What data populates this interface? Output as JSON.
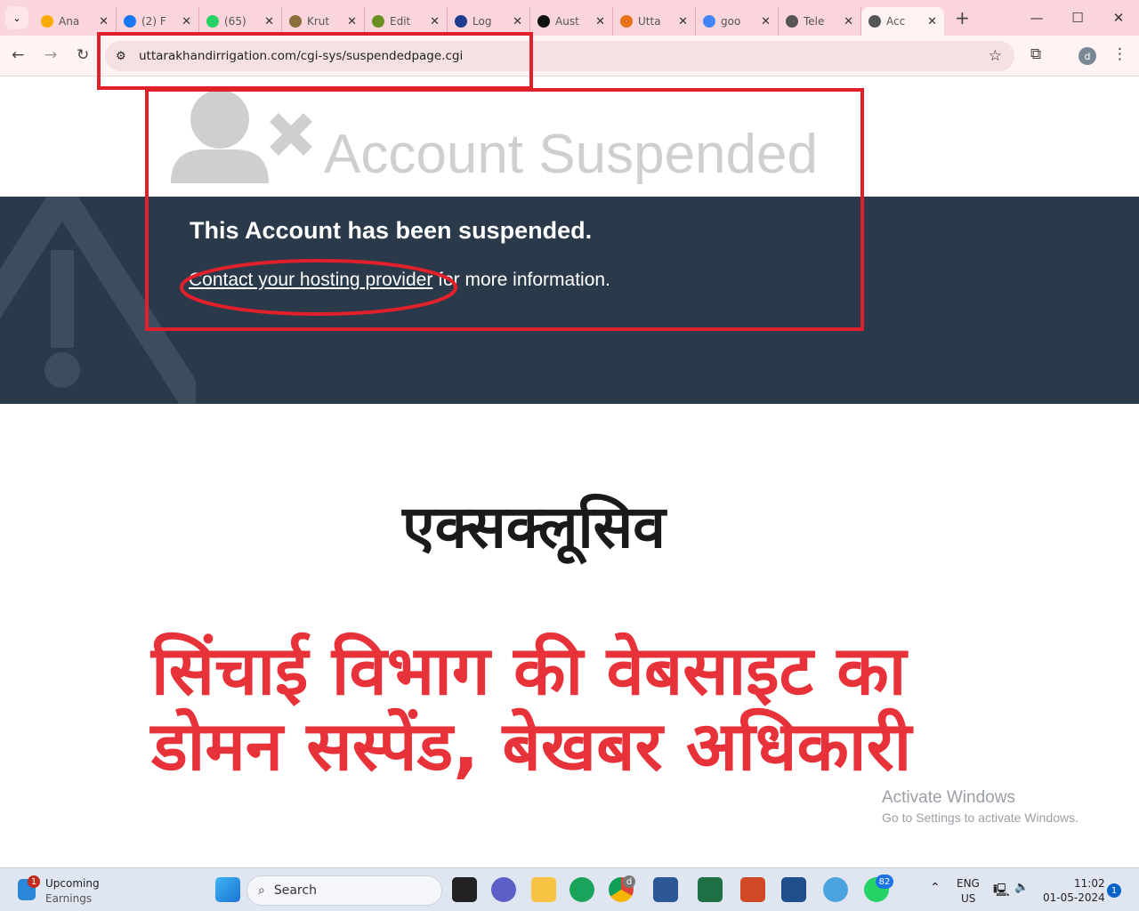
{
  "browser": {
    "tabs": [
      {
        "title": "Ana",
        "icon": "analytics-icon",
        "color": "#f9ab00"
      },
      {
        "title": "(2) F",
        "icon": "facebook-icon",
        "color": "#1877f2"
      },
      {
        "title": "(65)",
        "icon": "whatsapp-icon",
        "color": "#25d366"
      },
      {
        "title": "Krut",
        "icon": "krut-icon",
        "color": "#8a6d3b"
      },
      {
        "title": "Edit",
        "icon": "edit-site-icon",
        "color": "#6b8e23"
      },
      {
        "title": "Log",
        "icon": "login-icon",
        "color": "#1f3b8c"
      },
      {
        "title": "Aust",
        "icon": "hindi-a-icon",
        "color": "#111111"
      },
      {
        "title": "Utta",
        "icon": "sunrise-icon",
        "color": "#e8731a"
      },
      {
        "title": "goo",
        "icon": "google-icon",
        "color": "#4285f4"
      },
      {
        "title": "Tele",
        "icon": "globe-icon",
        "color": "#555555"
      },
      {
        "title": "Acc",
        "icon": "globe-icon",
        "color": "#555555",
        "active": true
      }
    ],
    "url": "uttarakhandirrigation.com/cgi-sys/suspendedpage.cgi",
    "profile_initial": "d"
  },
  "page": {
    "title": "Account Suspended",
    "heading": "This Account has been suspended.",
    "link": "Contact your hosting provider",
    "rest": " for more information.",
    "colors": {
      "band": "#2b3a4a",
      "annotation": "#e0202a",
      "headline": "#e8323a"
    }
  },
  "overlay": {
    "exclusive": "एक्सक्लूसिव",
    "headline_line1": "सिंचाई विभाग की  वेबसाइट का",
    "headline_line2": "डोमन सस्पेंड, बेखबर अधिकारी"
  },
  "watermark": {
    "line1": "Activate Windows",
    "line2": "Go to Settings to activate Windows."
  },
  "taskbar": {
    "widget_title": "Upcoming",
    "widget_sub": "Earnings",
    "widget_badge": "1",
    "search": "Search",
    "chrome_badge": "d",
    "whatsapp_badge": "82",
    "lang1": "ENG",
    "lang2": "US",
    "time": "11:02",
    "date": "01-05-2024",
    "notif": "1"
  }
}
